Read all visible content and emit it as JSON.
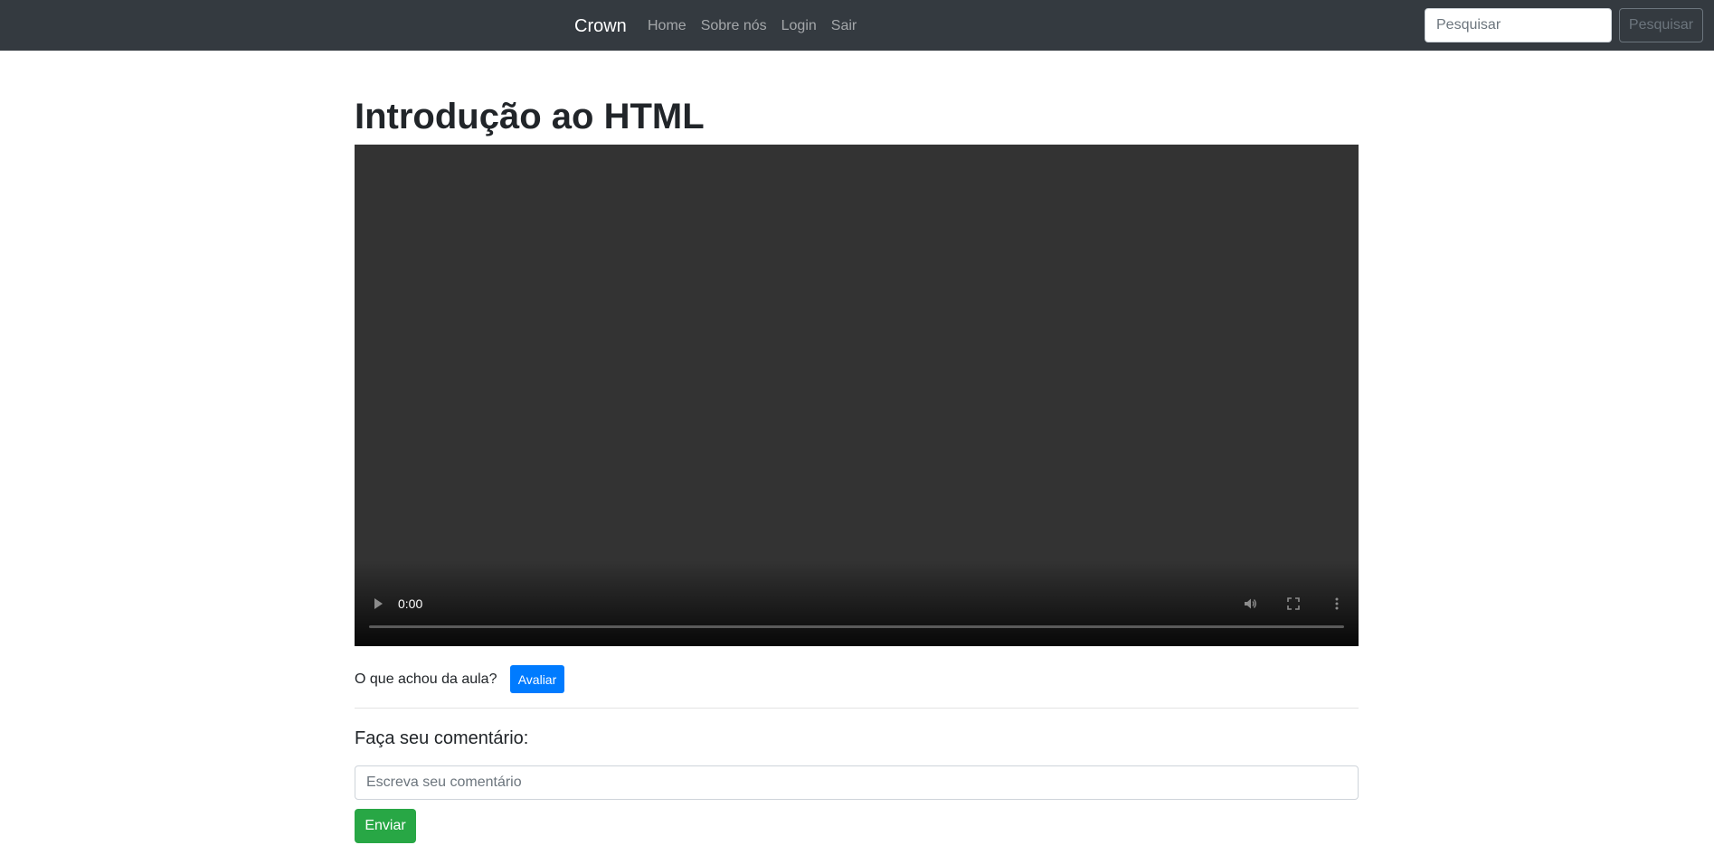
{
  "navbar": {
    "brand": "Crown",
    "links": [
      {
        "label": "Home"
      },
      {
        "label": "Sobre nós"
      },
      {
        "label": "Login"
      },
      {
        "label": "Sair"
      }
    ],
    "search": {
      "placeholder": "Pesquisar",
      "value": "",
      "button_label": "Pesquisar"
    },
    "colors": {
      "background": "#343a40"
    }
  },
  "main": {
    "title": "Introdução ao HTML",
    "video": {
      "current_time": "0:00",
      "progress": 0,
      "icons": [
        "play-icon",
        "volume-icon",
        "fullscreen-icon",
        "more-options-icon"
      ]
    },
    "rating": {
      "label": "O que achou da aula?",
      "button_label": "Avaliar"
    },
    "comment": {
      "heading": "Faça seu comentário:",
      "placeholder": "Escreva seu comentário",
      "value": "",
      "submit_label": "Enviar"
    }
  },
  "colors": {
    "primary": "#007bff",
    "success": "#28a745",
    "video_background": "#333333"
  }
}
